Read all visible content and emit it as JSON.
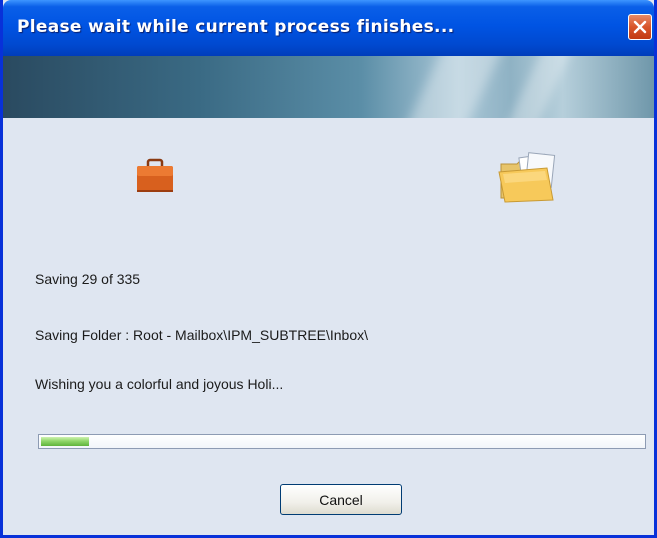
{
  "window": {
    "title": "Please wait while current process finishes...",
    "close_icon": "close-icon"
  },
  "icons": {
    "source": "briefcase-icon",
    "destination": "folder-icon"
  },
  "status": {
    "progress_text": "Saving 29 of 335",
    "folder_text": "Saving Folder : Root - Mailbox\\IPM_SUBTREE\\Inbox\\",
    "message_text": "Wishing you a colorful and joyous Holi..."
  },
  "progress": {
    "fraction": 0.08
  },
  "buttons": {
    "cancel_label": "Cancel"
  },
  "colors": {
    "titlebar": "#0054e3",
    "body": "#dfe6f1",
    "progress_fill": "#8fd66a",
    "close_button": "#d8552a"
  }
}
